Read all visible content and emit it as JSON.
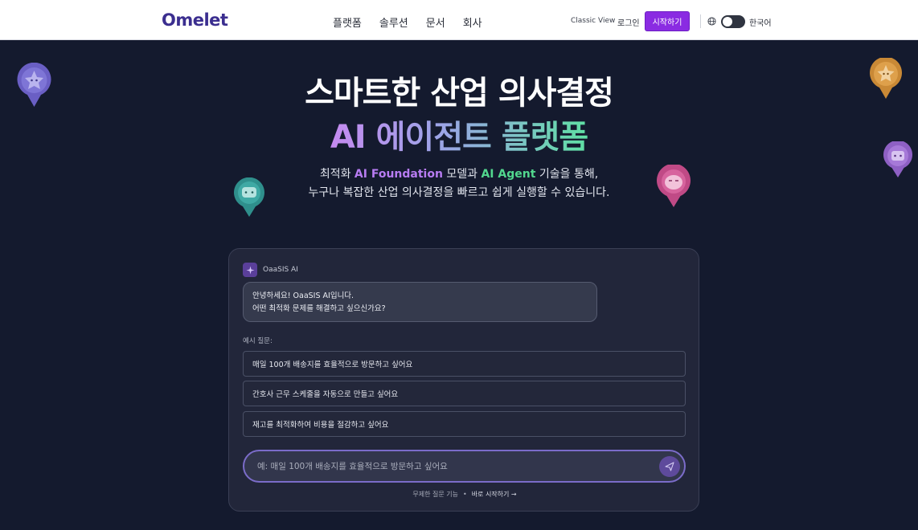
{
  "header": {
    "logo": "Omelet",
    "nav": [
      "플랫폼",
      "솔루션",
      "문서",
      "회사"
    ],
    "classic_view": "Classic View",
    "login": "로그인",
    "start": "시작하기",
    "language": "한국어",
    "brand_color": "#8a2be2"
  },
  "hero": {
    "title_line1": "스마트한 산업 의사결정",
    "title_line2": "AI 에이전트 플랫폼",
    "sub_line1_a": "최적화 ",
    "sub_line1_b": "AI Foundation",
    "sub_line1_c": " 모델과 ",
    "sub_line1_d": "AI Agent",
    "sub_line1_e": " 기술을 통해,",
    "sub_line2": "누구나 복잡한 산업 의사결정을 빠르고 쉽게 실행할 수 있습니다."
  },
  "chat": {
    "bot_name": "OaaSIS AI",
    "greeting_line1": "안녕하세요! OaaSIS AI입니다.",
    "greeting_line2": "어떤 최적화 문제를 해결하고 싶으신가요?",
    "examples_label": "예시 질문:",
    "examples": [
      "매일 100개 배송지를 효율적으로 방문하고 싶어요",
      "간호사 근무 스케줄을 자동으로 만들고 싶어요",
      "재고를 최적화하여 비용을 절감하고 싶어요"
    ],
    "input_placeholder": "예: 매일 100개 배송지를 효율적으로 방문하고 싶어요",
    "footnote": "무제한 질문 기능",
    "footnote_link": "바로 시작하기 →"
  },
  "icons": {
    "pins": [
      "purple-star-pin-icon",
      "orange-star-pin-icon",
      "violet-robot-pin-icon",
      "teal-robot-pin-icon",
      "pink-face-pin-icon"
    ],
    "globe": "globe-icon",
    "send": "send-icon"
  }
}
